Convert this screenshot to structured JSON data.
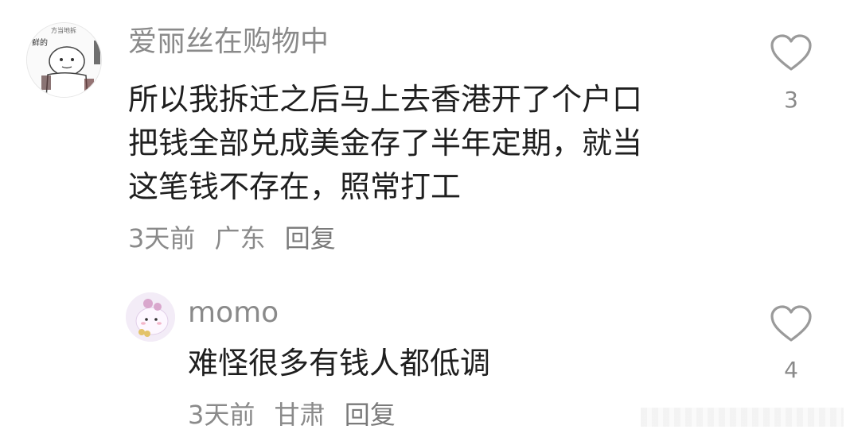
{
  "comments": [
    {
      "username": "爱丽丝在购物中",
      "lines": [
        "所以我拆迁之后马上去香港开了个户口",
        "把钱全部兑成美金存了半年定期，就当",
        "这笔钱不存在，照常打工"
      ],
      "time": "3天前",
      "location": "广东",
      "reply_label": "回复",
      "likes": "3",
      "avatar_icon": "sketch-character-avatar",
      "avatar_text": "鲜的"
    },
    {
      "username": "momo",
      "lines": [
        "难怪很多有钱人都低调"
      ],
      "time": "3天前",
      "location": "甘肃",
      "reply_label": "回复",
      "likes": "4",
      "avatar_icon": "pink-creature-avatar"
    }
  ],
  "colors": {
    "meta_gray": "#8a8a8a",
    "text_dark": "#1f1f1f",
    "heart_stroke": "#9a9a9a"
  }
}
